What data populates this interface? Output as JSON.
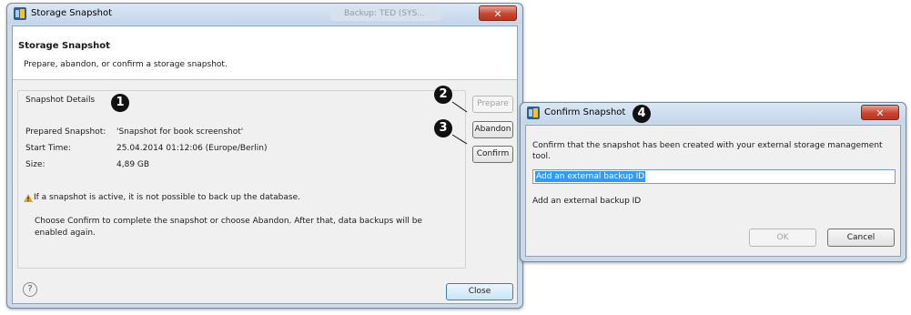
{
  "main_dialog": {
    "title": "Storage Snapshot",
    "background_tab": "Backup: TED (SYS...",
    "close_glyph": "✕",
    "heading": "Storage Snapshot",
    "description": "Prepare, abandon, or confirm a storage snapshot.",
    "group_label": "Snapshot Details",
    "details": [
      {
        "label": "Prepared Snapshot:",
        "value": "'Snapshot for book screenshot'"
      },
      {
        "label": "Start Time:",
        "value": "25.04.2014 01:12:06 (Europe/Berlin)"
      },
      {
        "label": "Size:",
        "value": "4,89 GB"
      }
    ],
    "warning": "If a snapshot is active, it is not possible to back up the database.",
    "info_line1": "Choose Confirm to complete the snapshot or choose Abandon. After that, data backups will be",
    "info_line2": "enabled again.",
    "buttons": {
      "prepare": "Prepare",
      "abandon": "Abandon",
      "confirm": "Confirm",
      "close": "Close"
    },
    "help_glyph": "?"
  },
  "confirm_dialog": {
    "title": "Confirm Snapshot",
    "close_glyph": "✕",
    "message_line1": "Confirm that the snapshot has been created with your external storage management",
    "message_line2": "tool.",
    "input_value": "Add an external backup ID",
    "hint": "Add an external backup ID",
    "buttons": {
      "ok": "OK",
      "cancel": "Cancel"
    }
  },
  "callouts": [
    "1",
    "2",
    "3",
    "4"
  ],
  "colors": {
    "title_gradient_top": "#dbe8f5",
    "close_red": "#c8452e",
    "selection_blue": "#3399ff",
    "warning_orange": "#e8a317"
  }
}
